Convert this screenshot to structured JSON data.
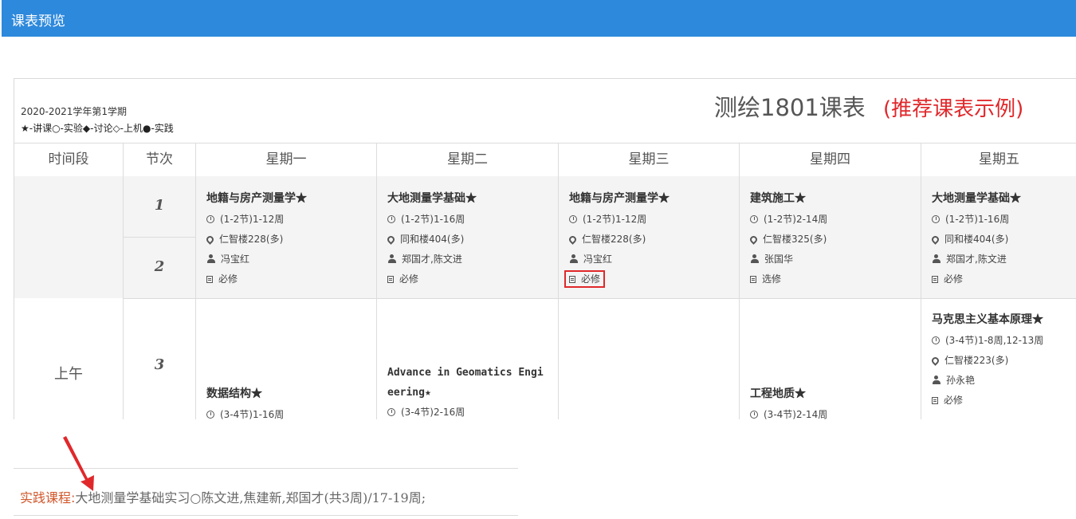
{
  "window": {
    "title": "课表预览"
  },
  "header": {
    "term": "2020-2021学年第1学期",
    "legend": "★-讲课○-实验◆-讨论◇-上机●-实践",
    "title": "测绘1801课表",
    "subtitle": "(推荐课表示例)"
  },
  "columns": [
    "时间段",
    "节次",
    "星期一",
    "星期二",
    "星期三",
    "星期四",
    "星期五"
  ],
  "period": "上午",
  "sections": [
    "1",
    "2",
    "3"
  ],
  "courses_12": [
    {
      "name": "地籍与房产测量学★",
      "time": "(1-2节)1-12周",
      "room": "仁智楼228(多)",
      "teacher": "冯宝红",
      "type": "必修"
    },
    {
      "name": "大地测量学基础★",
      "time": "(1-2节)1-16周",
      "room": "同和楼404(多)",
      "teacher": "郑国才,陈文进",
      "type": "必修"
    },
    {
      "name": "地籍与房产测量学★",
      "time": "(1-2节)1-12周",
      "room": "仁智楼228(多)",
      "teacher": "冯宝红",
      "type": "必修"
    },
    {
      "name": "建筑施工★",
      "time": "(1-2节)2-14周",
      "room": "仁智楼325(多)",
      "teacher": "张国华",
      "type": "选修"
    },
    {
      "name": "大地测量学基础★",
      "time": "(1-2节)1-16周",
      "room": "同和楼404(多)",
      "teacher": "郑国才,陈文进",
      "type": "必修"
    }
  ],
  "courses_34": {
    "mon": {
      "name": "数据结构★",
      "time": "(3-4节)1-16周"
    },
    "tue": {
      "name_1": "Advance in Geomatics Engi",
      "name_2": "eering★",
      "time": "(3-4节)2-16周"
    },
    "thu": {
      "name": "工程地质★",
      "time": "(3-4节)2-14周"
    },
    "fri": {
      "name": "马克思主义基本原理★",
      "time": "(3-4节)1-8周,12-13周",
      "room": "仁智楼223(多)",
      "teacher": "孙永艳",
      "type": "必修"
    }
  },
  "practice": {
    "label": "实践课程:",
    "text": "大地测量学基础实习○陈文进,焦建新,郑国才(共3周)/17-19周;"
  },
  "colors": {
    "titlebar": "#2d89dc",
    "accent_red": "#e0282b",
    "practice_label": "#d2572b"
  },
  "icons": [
    "clock-icon",
    "location-icon",
    "user-icon",
    "doc-icon",
    "arrow-annotation"
  ]
}
